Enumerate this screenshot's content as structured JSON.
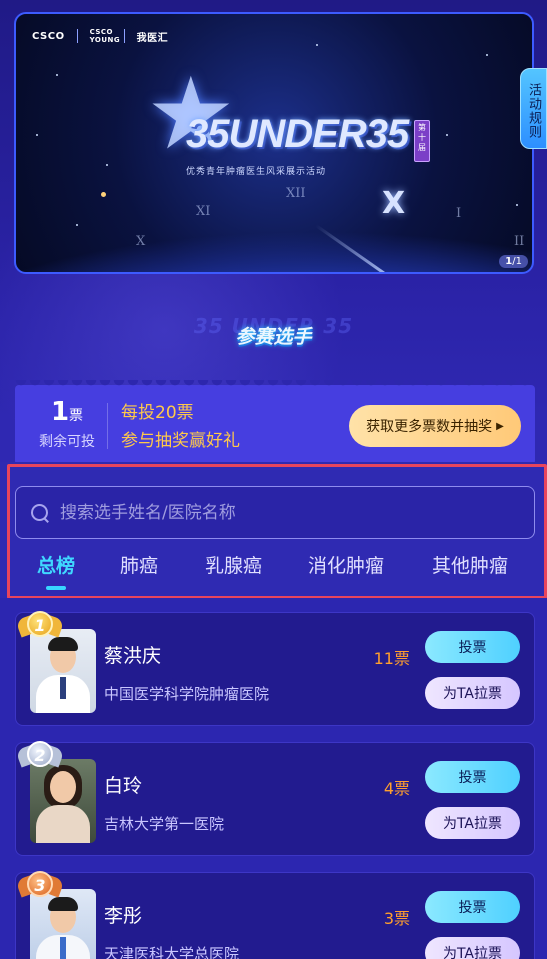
{
  "banner": {
    "logos": [
      "CSCO",
      "CSCO YOUNG",
      "我医汇"
    ],
    "title": "35UNDER35",
    "edition": "第十届",
    "subtitle": "优秀青年肿瘤医生风采展示活动",
    "pager_current": "1",
    "pager_total": "/1"
  },
  "rules_tab": "活动规则",
  "section": {
    "ghost": "35 UNDER 35",
    "title": "参赛选手"
  },
  "vote": {
    "count": "1",
    "unit": "票",
    "label": "剩余可投",
    "promo_line1": "每投20票",
    "promo_line2": "参与抽奖赢好礼",
    "button": "获取更多票数并抽奖"
  },
  "search": {
    "placeholder": "搜索选手姓名/医院名称",
    "value": ""
  },
  "tabs": [
    {
      "label": "总榜",
      "active": true
    },
    {
      "label": "肺癌",
      "active": false
    },
    {
      "label": "乳腺癌",
      "active": false
    },
    {
      "label": "消化肿瘤",
      "active": false
    },
    {
      "label": "其他肿瘤",
      "active": false
    }
  ],
  "candidates": [
    {
      "rank": "1",
      "name": "蔡洪庆",
      "hospital": "中国医学科学院肿瘤医院",
      "votes": "11票",
      "vote_btn": "投票",
      "pull_btn": "为TA拉票"
    },
    {
      "rank": "2",
      "name": "白玲",
      "hospital": "吉林大学第一医院",
      "votes": "4票",
      "vote_btn": "投票",
      "pull_btn": "为TA拉票"
    },
    {
      "rank": "3",
      "name": "李彤",
      "hospital": "天津医科大学总医院",
      "votes": "3票",
      "vote_btn": "投票",
      "pull_btn": "为TA拉票"
    }
  ],
  "colors": {
    "background": "#2c26b0",
    "accent_cyan": "#3fd8ff",
    "vote_orange": "#ff9f2e",
    "promo_gold": "#ffc94a",
    "highlight_red": "#e8455d"
  }
}
